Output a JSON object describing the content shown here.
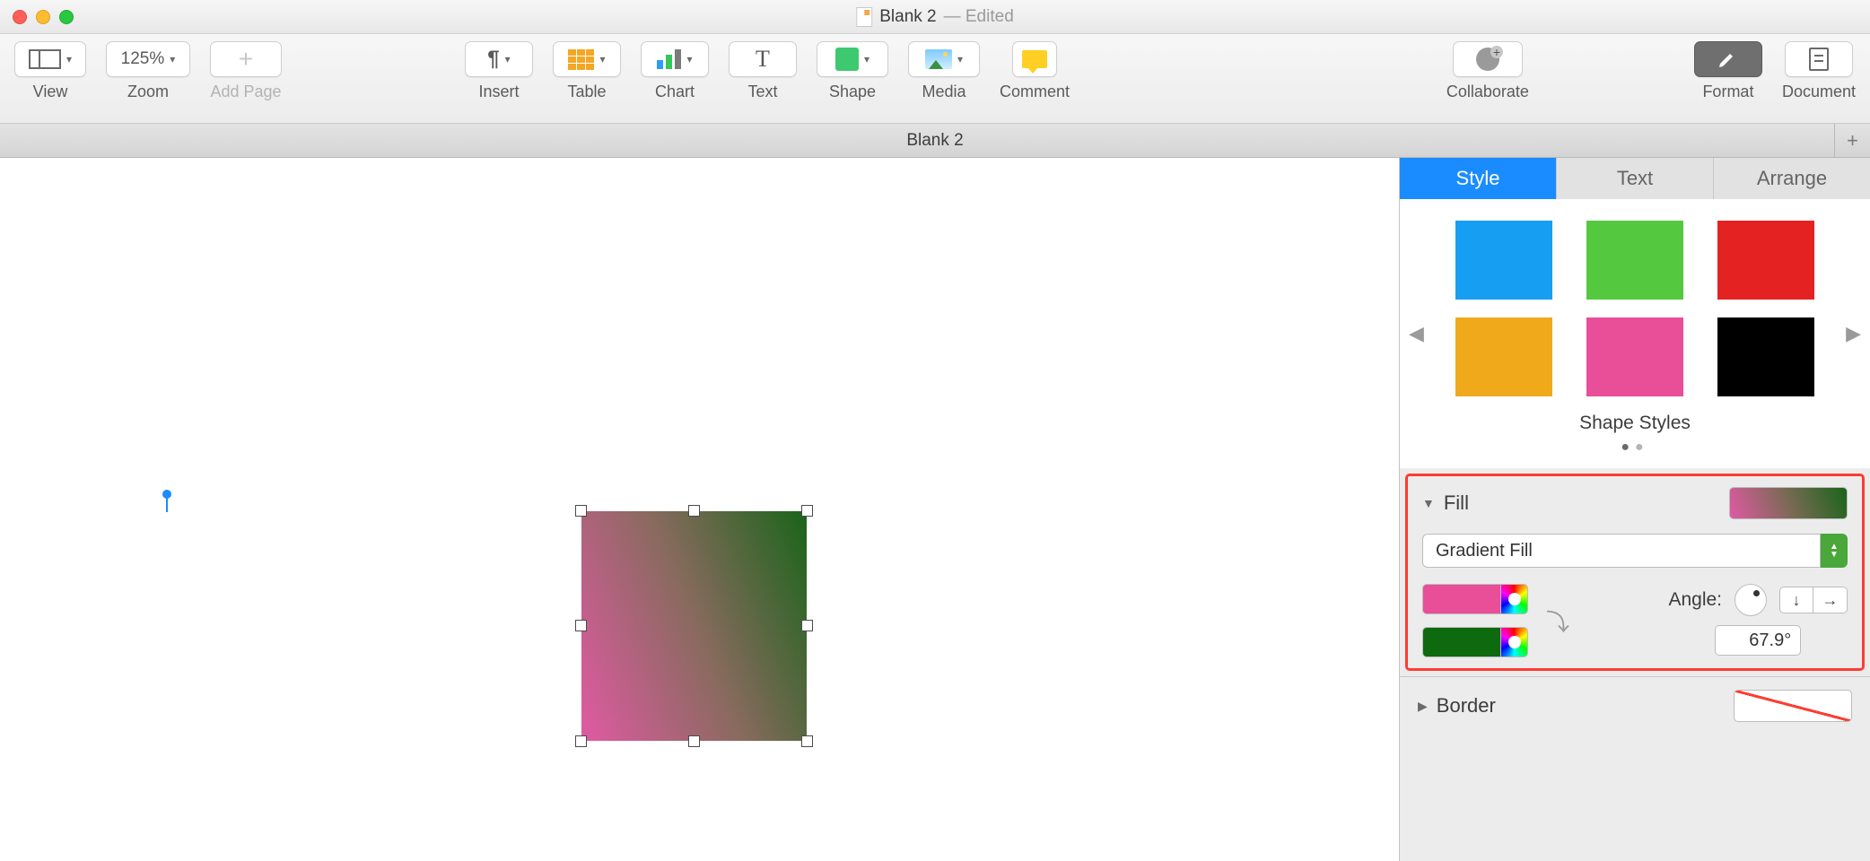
{
  "window": {
    "doc_name": "Blank 2",
    "status": "— Edited"
  },
  "toolbar": {
    "view": "View",
    "zoom_label": "Zoom",
    "zoom_value": "125%",
    "add_page": "Add Page",
    "insert": "Insert",
    "table": "Table",
    "chart": "Chart",
    "text": "Text",
    "shape": "Shape",
    "media": "Media",
    "comment": "Comment",
    "collaborate": "Collaborate",
    "format": "Format",
    "document": "Document"
  },
  "tabbar": {
    "tab1": "Blank 2"
  },
  "sidebar": {
    "tabs": {
      "style": "Style",
      "text": "Text",
      "arrange": "Arrange"
    },
    "styles_title": "Shape Styles",
    "swatches": [
      "#169ef3",
      "#54c93f",
      "#e52222",
      "#f1a91c",
      "#e94e98",
      "#000000"
    ],
    "fill": {
      "label": "Fill",
      "type": "Gradient Fill",
      "stop1": "#e94e98",
      "stop2": "#0e6a0e",
      "angle_label": "Angle:",
      "angle_value": "67.9°"
    },
    "border": {
      "label": "Border"
    }
  }
}
